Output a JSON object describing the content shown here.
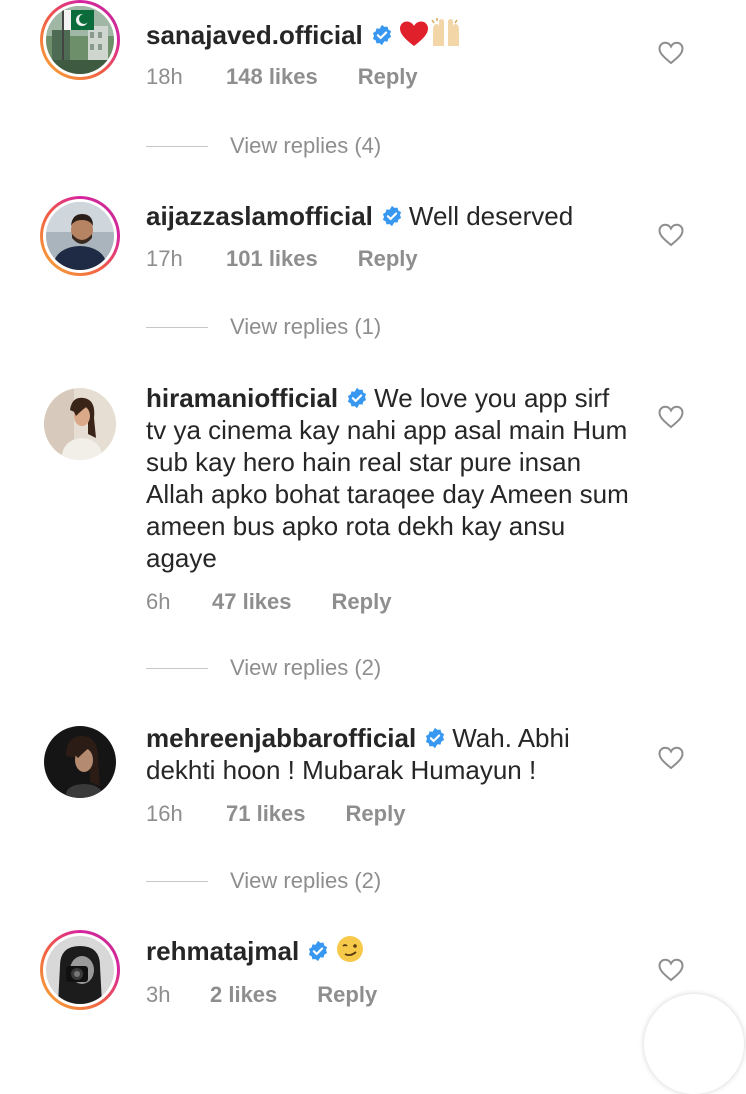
{
  "comments": [
    {
      "username": "sanajaved.official",
      "text": "",
      "emoji": [
        "red-heart-emoji",
        "raising-hands-emoji"
      ],
      "time": "18h",
      "likes": "148 likes",
      "reply": "Reply",
      "view_replies": "View replies (4)",
      "avatar": "avatar-flag-building"
    },
    {
      "username": "aijazzaslamofficial",
      "text": "Well deserved",
      "time": "17h",
      "likes": "101 likes",
      "reply": "Reply",
      "view_replies": "View replies (1)",
      "avatar": "avatar-man-bearded"
    },
    {
      "username": "hiramaniofficial",
      "text": "We love you app sirf tv ya cinema kay nahi app asal main Hum sub kay hero hain real star pure insan Allah apko bohat taraqee day Ameen sum ameen bus apko rota dekh kay ansu agaye",
      "time": "6h",
      "likes": "47 likes",
      "reply": "Reply",
      "view_replies": "View replies (2)",
      "avatar": "avatar-woman-light"
    },
    {
      "username": "mehreenjabbarofficial",
      "text": "Wah. Abhi dekhti hoon !  Mubarak Humayun !",
      "time": "16h",
      "likes": "71 likes",
      "reply": "Reply",
      "view_replies": "View replies (2)",
      "avatar": "avatar-woman-dark"
    },
    {
      "username": "rehmatajmal",
      "text": "",
      "emoji": [
        "winking-face-emoji"
      ],
      "time": "3h",
      "likes": "2 likes",
      "reply": "Reply",
      "avatar": "avatar-camera-bw"
    }
  ],
  "icons": {
    "verified": "verified-badge-icon",
    "like": "heart-outline-icon"
  },
  "colors": {
    "verified_blue": "#3897f0",
    "meta_gray": "#8e8e8e",
    "text_dark": "#262626",
    "heart_red": "#ed4956"
  }
}
